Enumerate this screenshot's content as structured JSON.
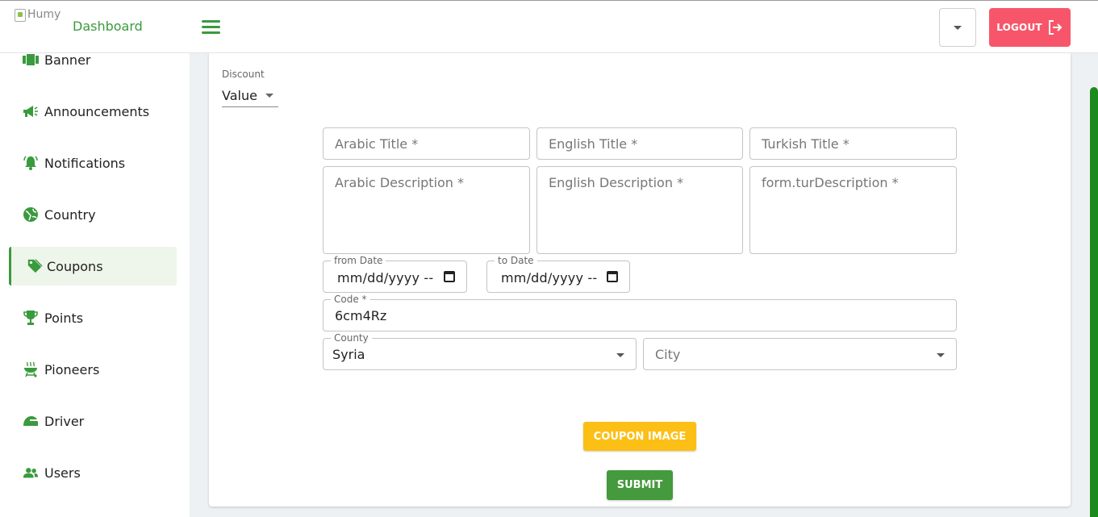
{
  "header": {
    "logo_alt": "Humy",
    "app_title": "Dashboard",
    "logout_label": "LOGOUT"
  },
  "sidebar": {
    "items": [
      {
        "label": "Banner",
        "icon": "banner-icon"
      },
      {
        "label": "Announcements",
        "icon": "megaphone-icon"
      },
      {
        "label": "Notifications",
        "icon": "bell-icon"
      },
      {
        "label": "Country",
        "icon": "globe-icon"
      },
      {
        "label": "Coupons",
        "icon": "tag-icon",
        "active": true
      },
      {
        "label": "Points",
        "icon": "trophy-icon"
      },
      {
        "label": "Pioneers",
        "icon": "grill-icon"
      },
      {
        "label": "Driver",
        "icon": "helmet-icon"
      },
      {
        "label": "Users",
        "icon": "users-icon"
      }
    ]
  },
  "form": {
    "discount_label": "Discount",
    "discount_value": "Value",
    "arabic_title_placeholder": "Arabic Title *",
    "english_title_placeholder": "English Title *",
    "turkish_title_placeholder": "Turkish Title *",
    "arabic_description_placeholder": "Arabic Description *",
    "english_description_placeholder": "English Description *",
    "turkish_description_placeholder": "form.turDescription *",
    "from_date_label": "from Date",
    "from_date_value": "mm/dd/yyyy --",
    "to_date_label": "to Date",
    "to_date_value": "mm/dd/yyyy --",
    "code_label": "Code *",
    "code_value": "6cm4Rz",
    "county_label": "County",
    "county_value": "Syria",
    "city_placeholder": "City",
    "coupon_image_label": "COUPON IMAGE",
    "submit_label": "SUBMIT"
  },
  "colors": {
    "brand_green": "#3a9a3e",
    "logout_red": "#f7566a",
    "image_button_yellow": "#fbbf16",
    "submit_green": "#449a3c",
    "scroll_thumb": "#1c8a1c"
  }
}
